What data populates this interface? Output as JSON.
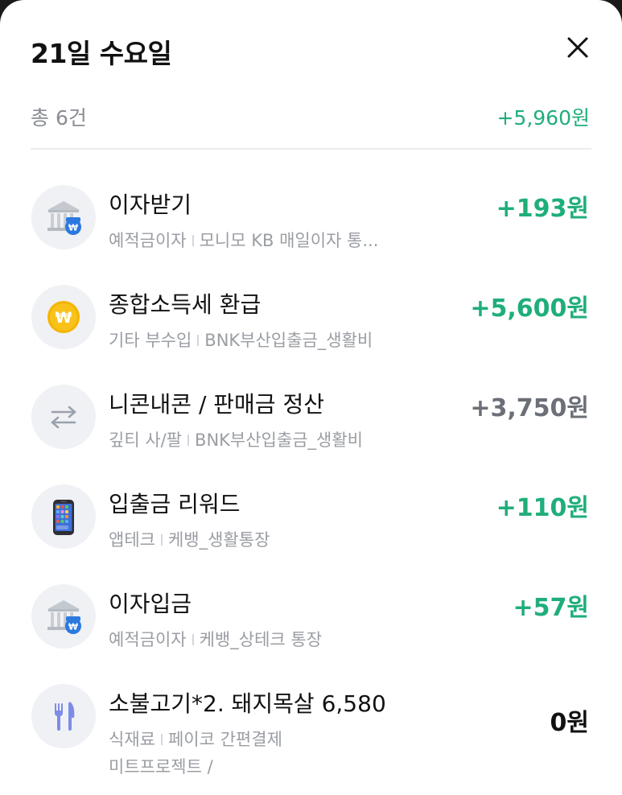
{
  "header": {
    "title": "21일 수요일"
  },
  "summary": {
    "count": "총 6건",
    "total": "+5,960원"
  },
  "colors": {
    "positive": "#1fae7a",
    "neutral": "#6b6f77",
    "icon_bg": "#f0f1f4"
  },
  "transactions": [
    {
      "icon": "bank-icon",
      "title": "이자받기",
      "category": "예적금이자",
      "account": "모니모 KB 매일이자 통...",
      "amount": "+193원"
    },
    {
      "icon": "won-coin-icon",
      "title": "종합소득세 환급",
      "category": "기타 부수입",
      "account": "BNK부산입출금_생활비",
      "amount": "+5,600원"
    },
    {
      "icon": "transfer-arrows-icon",
      "title": "니콘내콘 / 판매금 정산",
      "category": "깊티 사/팔",
      "account": "BNK부산입출금_생활비",
      "amount": "+3,750원"
    },
    {
      "icon": "mobile-phone-icon",
      "title": "입출금 리워드",
      "category": "앱테크",
      "account": "케뱅_생활통장",
      "amount": "+110원"
    },
    {
      "icon": "bank-icon",
      "title": "이자입금",
      "category": "예적금이자",
      "account": "케뱅_상테크 통장",
      "amount": "+57원"
    },
    {
      "icon": "fork-knife-icon",
      "title": "소불고기*2. 돼지목살 6,580",
      "category": "식재료",
      "account": "페이코 간편결제",
      "account_line2": "미트프로젝트 /",
      "amount": "0원"
    }
  ]
}
